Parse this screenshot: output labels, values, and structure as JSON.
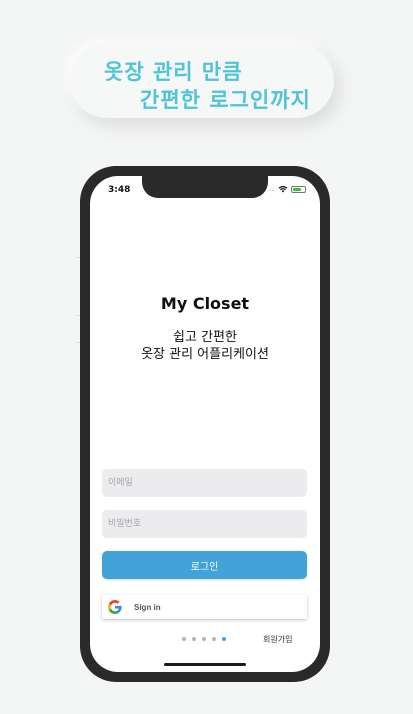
{
  "banner": {
    "line1": "옷장 관리 만큼",
    "line2": "간편한 로그인까지"
  },
  "status_bar": {
    "time": "3:48",
    "signal": "....",
    "battery_color": "#3cc13b"
  },
  "app": {
    "title": "My Closet",
    "subtitle_line1": "쉽고 간편한",
    "subtitle_line2": "옷장 관리 어플리케이션"
  },
  "form": {
    "email_placeholder": "이메일",
    "password_placeholder": "비밀번호",
    "login_label": "로그인",
    "google_label": "Sign in",
    "signup_label": "회원가입"
  },
  "pagination": {
    "total": 5,
    "active_index": 4
  },
  "colors": {
    "accent": "#41a3d8",
    "banner_text": "#4fc3d8"
  },
  "icons": [
    "wifi-icon",
    "battery-icon",
    "google-icon"
  ]
}
